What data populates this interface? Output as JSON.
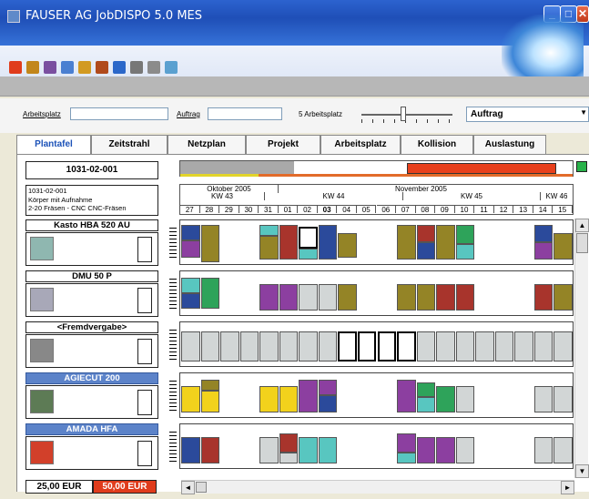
{
  "window": {
    "title": "FAUSER AG JobDISPO 5.0 MES",
    "controls": [
      "_",
      "□",
      "✕"
    ]
  },
  "toolbar": {
    "icons": [
      {
        "name": "stop-icon",
        "color": "#e03c1c"
      },
      {
        "name": "grid-icon",
        "color": "#c2861b"
      },
      {
        "name": "list-icon",
        "color": "#7a4fa0"
      },
      {
        "name": "machine-icon",
        "color": "#4a7fd1"
      },
      {
        "name": "tools-icon",
        "color": "#d29a22"
      },
      {
        "name": "network-icon",
        "color": "#b04a1c"
      },
      {
        "name": "info-icon",
        "color": "#2b67c9"
      },
      {
        "name": "printer-icon",
        "color": "#777777"
      },
      {
        "name": "layout-icon",
        "color": "#8b8b8b"
      },
      {
        "name": "image-icon",
        "color": "#5aa0d0"
      }
    ]
  },
  "filters": {
    "arbeitsplatz_label": "Arbeitsplatz",
    "arbeitsplatz_value": "",
    "auftrag_label": "Auftrag",
    "auftrag_value": "",
    "slider_label": "5 Arbeitsplatz",
    "combo_value": "Auftrag"
  },
  "tabs": [
    "Plantafel",
    "Zeitstrahl",
    "Netzplan",
    "Projekt",
    "Arbeitsplatz",
    "Kollision",
    "Auslastung"
  ],
  "job": {
    "number": "1031-02-001",
    "info_lines": [
      "1031-02-001",
      "Körper mit Aufnahme",
      "2-20 Fräsen - CNC  CNC-Fräsen"
    ]
  },
  "calendar": {
    "months": [
      "Oktober 2005",
      "November 2005"
    ],
    "weeks": [
      "KW 43",
      "KW 44",
      "KW 45",
      "KW 46"
    ],
    "days": [
      "27",
      "28",
      "29",
      "30",
      "31",
      "01",
      "02",
      "03",
      "04",
      "05",
      "06",
      "07",
      "08",
      "09",
      "10",
      "11",
      "12",
      "13",
      "14",
      "15"
    ],
    "highlight_day": "03"
  },
  "machines": [
    {
      "name": "Kasto  HBA 520 AU",
      "style": "plain",
      "pic_color": "#8fb7b0"
    },
    {
      "name": "DMU 50 P",
      "style": "plain",
      "pic_color": "#a8a8b8"
    },
    {
      "name": "<Fremdvergabe>",
      "style": "plain",
      "pic_color": "#888888"
    },
    {
      "name": "AGIECUT 200",
      "style": "blue",
      "pic_color": "#5d7b55"
    },
    {
      "name": "AMADA HFA",
      "style": "blue",
      "pic_color": "#d2402a"
    }
  ],
  "costs": {
    "cost_a": "25,00 EUR",
    "cost_b": "50,00 EUR"
  },
  "colors": {
    "olive": "#948426",
    "purple": "#8c3fa0",
    "navy": "#2b4a9b",
    "red": "#a8342c",
    "teal": "#58c6c0",
    "green": "#2ea35a",
    "yellow": "#f2d21c",
    "grey": "#d2d6d6",
    "orange": "#e8401c"
  }
}
